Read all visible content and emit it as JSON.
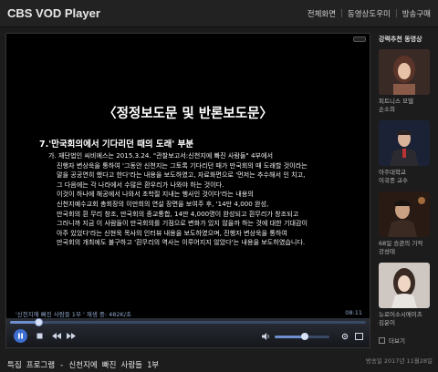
{
  "header": {
    "title": "CBS VOD Player",
    "nav": [
      "전체화면",
      "동영상도우미",
      "방송구매"
    ]
  },
  "slide": {
    "title": "〈정정보도문 및 반론보도문〉",
    "section": "7.'만국회의에서 기다리던 때의 도래' 부분",
    "lines": [
      "가. 재단법인 씨비에스는 2015.3.24. \"관찰보고서:신천지에 빠진 사람들\" 4부에서",
      "진행자 변상욱을 통하여 '그동안 신천지는 그토록 기다리던 때가 만국회의 때 도래할 것이라는",
      "말을 공공연히 했다고 한다'라는 내용을 보도하였고, 자료화면으로 '먼저는 추수해서 인 치고,",
      "그 다음에는 각 나라에서 수많은 환우리가 나와야 하는 것이다.",
      "이것이 하나에 해공에서 나와서 초학절 지내는 행사인 것이다'라는 내용의",
      "신천지예수교회 총회장의 이만희의 연설 장면을 보여주 후, '14만 4,000 완성,",
      "만국회의 흰 무리 창조, 만국회의 종교통합, 14만 4,000명이 완성되고 흰무리가 창조되고",
      "그러니까 지금 이 사람들이 만국회의를 기점으로 변화가 있지 않을까 하는 것에 대한 기대감이",
      "아주 있었다'라는 신현욱 목사의 인터뷰 내용을 보도하였으며, 진행자 변상욱을 통하여",
      "만국회의 개최에도 불구하고 '흰무리의 역사는 이루어지지 않았다'는 내용을 보도하였습니다."
    ]
  },
  "player": {
    "caption": "'신천지에 빠진 사람들 1부 ' 재생 중: 482K/초",
    "time": "08:11",
    "progress": 0.08,
    "volume": 0.55
  },
  "bottom": {
    "program_title": "특집 프로그램 - 신천지에 빠진 사람들 1부",
    "broadcast_date": "방송일 2017년 11월28일"
  },
  "sidebar": {
    "header": "강력추천 동영상",
    "items": [
      {
        "label_line1": "피트니스 모델",
        "label_line2": "손소희",
        "color": "#7a4a3a"
      },
      {
        "label_line1": "아주대학교",
        "label_line2": "이국종 교수",
        "color": "#2d3a55"
      },
      {
        "label_line1": "68일 승관의 기적",
        "label_line2": "강성태",
        "color": "#553322"
      },
      {
        "label_line1": "뉴로어소시에이츠",
        "label_line2": "김윤이",
        "color": "#9a8a80"
      }
    ],
    "more_label": "더보기"
  }
}
